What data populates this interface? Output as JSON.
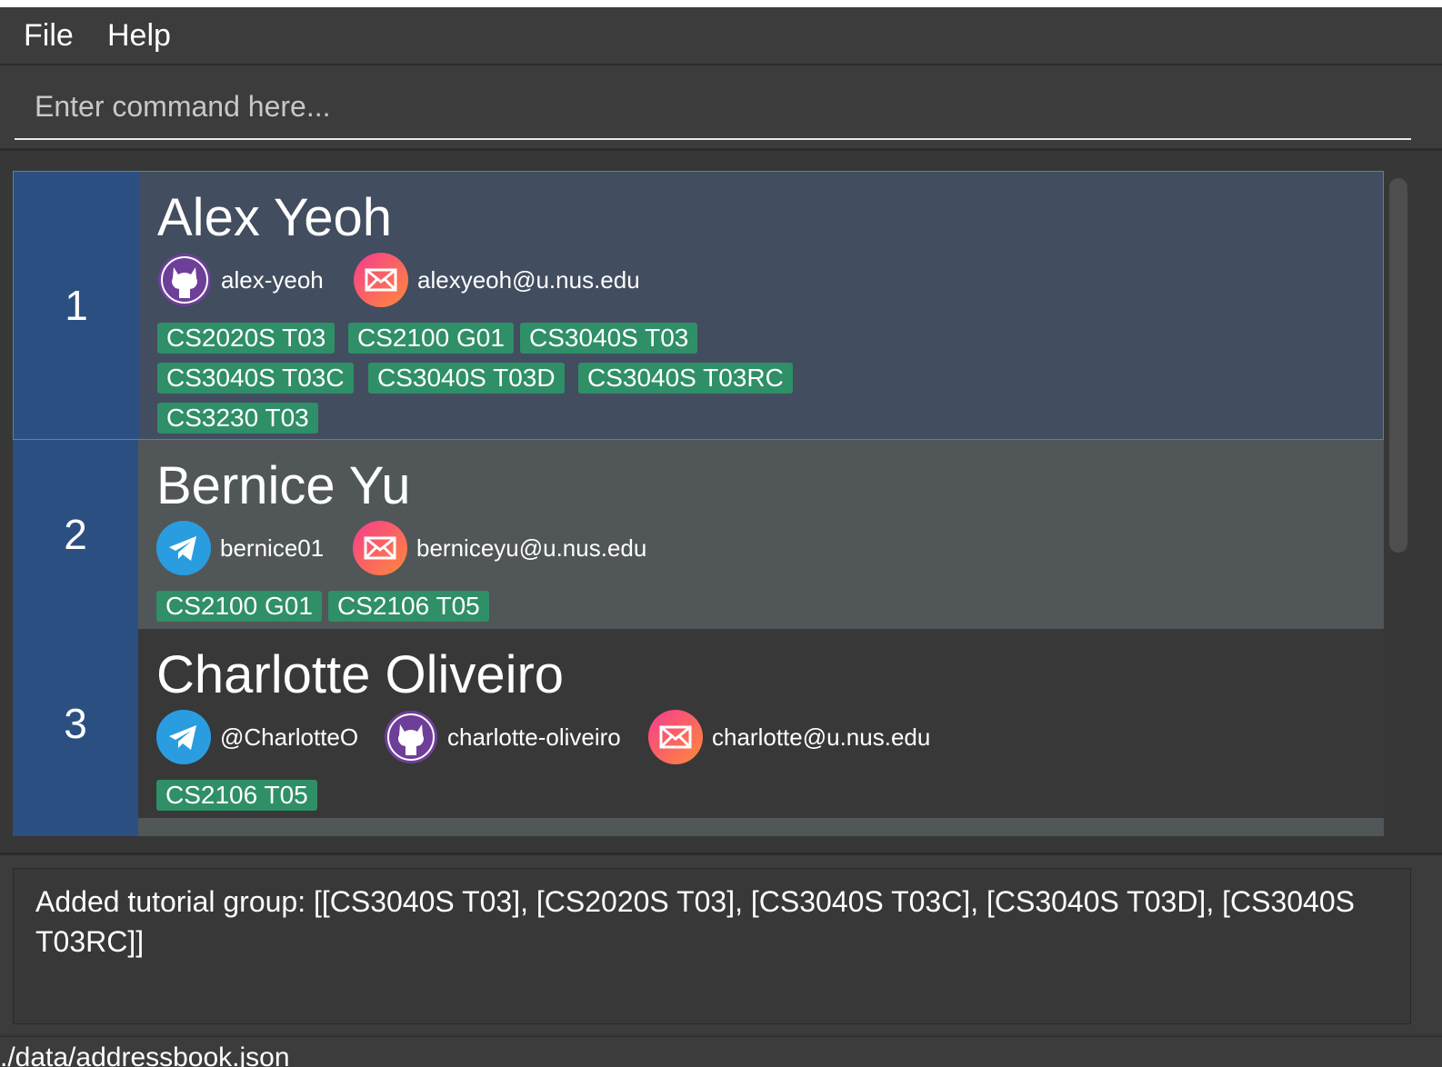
{
  "menu": {
    "file": "File",
    "help": "Help"
  },
  "command": {
    "placeholder": "Enter command here..."
  },
  "persons": [
    {
      "index": "1",
      "name": "Alex Yeoh",
      "github": "alex-yeoh",
      "email": "alexyeoh@u.nus.edu",
      "tags": [
        "CS2020S T03",
        "CS2100 G01",
        "CS3040S T03",
        "CS3040S T03C",
        "CS3040S T03D",
        "CS3040S T03RC",
        "CS3230 T03"
      ]
    },
    {
      "index": "2",
      "name": "Bernice Yu",
      "telegram": "bernice01",
      "email": "berniceyu@u.nus.edu",
      "tags": [
        "CS2100 G01",
        "CS2106 T05"
      ]
    },
    {
      "index": "3",
      "name": "Charlotte Oliveiro",
      "telegram": "@CharlotteO",
      "github": "charlotte-oliveiro",
      "email": "charlotte@u.nus.edu",
      "tags": [
        "CS2106 T05"
      ]
    }
  ],
  "result": {
    "message": "Added tutorial group: [[CS3040S T03], [CS2020S T03], [CS3040S T03C], [CS3040S T03D], [CS3040S T03RC]]"
  },
  "status": {
    "file_path": "./data/addressbook.json"
  },
  "icons": {
    "github": "github-icon",
    "telegram": "telegram-icon",
    "email": "email-icon"
  },
  "colors": {
    "index_column": "#2c4f82",
    "selected_card": "#424d5f",
    "alt_card": "#515658",
    "tag": "#2f8f67",
    "github_icon": "#6e3f99",
    "telegram_icon": "#2a9de1",
    "email_gradient": [
      "#f53c8e",
      "#ff8a3a"
    ]
  }
}
